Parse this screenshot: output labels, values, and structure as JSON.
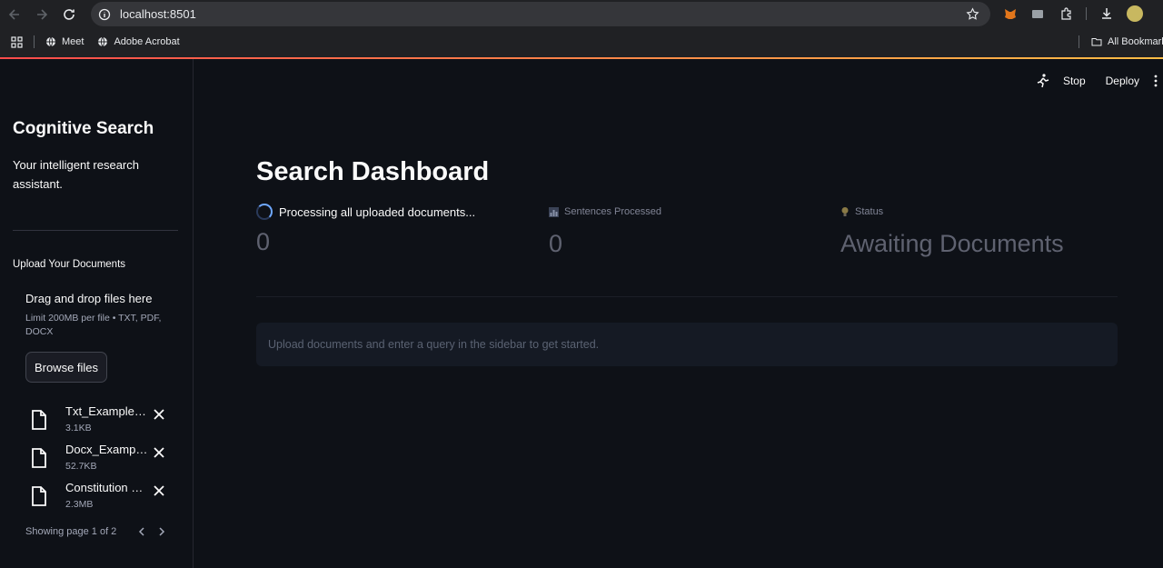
{
  "browser": {
    "url": "localhost:8501",
    "bookmarks": [
      "Meet",
      "Adobe Acrobat"
    ],
    "all_bookmarks": "All Bookmarks"
  },
  "sidebar": {
    "title": "Cognitive Search",
    "subtitle": "Your intelligent research assistant.",
    "upload_label": "Upload Your Documents",
    "drag_drop": "Drag and drop files here",
    "limit": "Limit 200MB per file • TXT, PDF, DOCX",
    "browse_label": "Browse files",
    "files": [
      {
        "name": "Txt_Example.txt",
        "size": "3.1KB"
      },
      {
        "name": "Docx_Example.docx",
        "size": "52.7KB"
      },
      {
        "name": "Constitution of India.pdf",
        "size": "2.3MB"
      }
    ],
    "pager": "Showing page 1 of 2"
  },
  "header": {
    "stop_label": "Stop",
    "deploy_label": "Deploy"
  },
  "main": {
    "title": "Search Dashboard",
    "metrics": [
      {
        "label": "Processing all uploaded documents...",
        "value": "0"
      },
      {
        "label": "Sentences Processed",
        "value": "0"
      },
      {
        "label": "Status",
        "value": "Awaiting Documents"
      }
    ],
    "info": "Upload documents and enter a query in the sidebar to get started."
  },
  "colors": {
    "accent_gradient_start": "#ff4b4b",
    "accent_gradient_end": "#ffbd45",
    "background": "#0e1117",
    "spinner": "#6fa8ff"
  }
}
